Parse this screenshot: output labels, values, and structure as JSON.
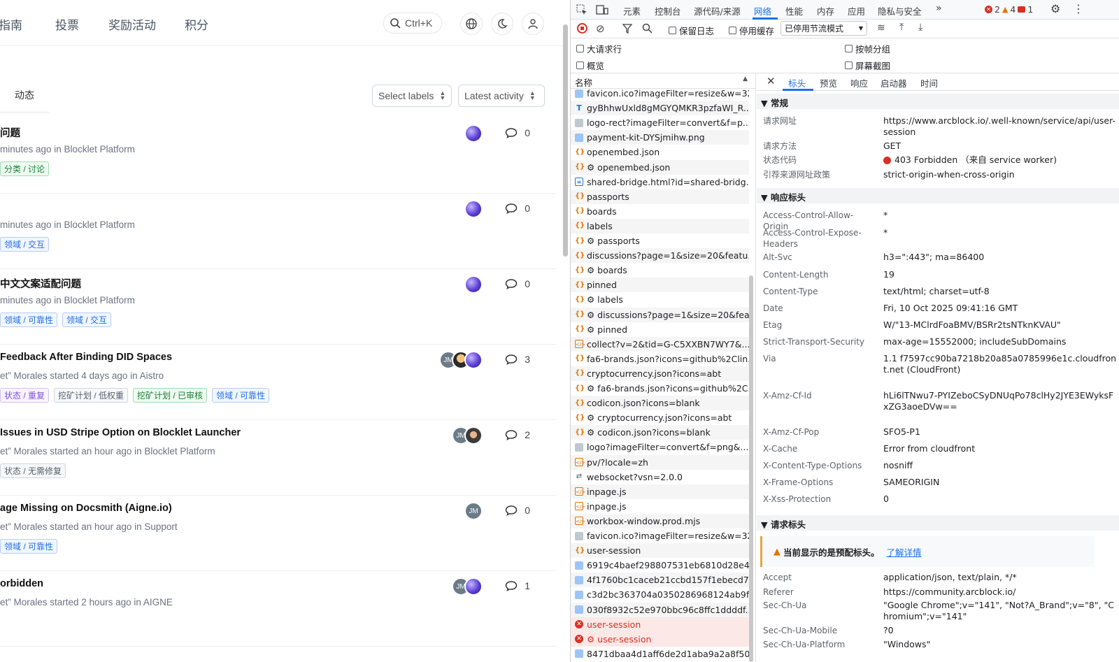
{
  "forum": {
    "nav": [
      "指南",
      "投票",
      "奖励活动",
      "积分"
    ],
    "search_shortcut": "Ctrl+K",
    "tab_label": "动态",
    "select_labels": "Select labels",
    "sort": "Latest activity",
    "topics": [
      {
        "title": "问题",
        "meta": "minutes ago in Blocklet Platform",
        "tags": [
          {
            "text": "分类 / 讨论",
            "color": "green"
          }
        ],
        "avatars": [
          "grad"
        ],
        "comments": "0"
      },
      {
        "title": "",
        "meta": "minutes ago in Blocklet Platform",
        "tags": [
          {
            "text": "领域 / 交互",
            "color": "blue"
          }
        ],
        "avatars": [
          "grad"
        ],
        "comments": "0"
      },
      {
        "title": "中文文案适配问题",
        "meta": "minutes ago in Blocklet Platform",
        "tags": [
          {
            "text": "领域 / 可靠性",
            "color": "blue"
          },
          {
            "text": "领域 / 交互",
            "color": "blue"
          }
        ],
        "avatars": [
          "grad"
        ],
        "comments": "0"
      },
      {
        "title": "Feedback After Binding DID Spaces",
        "meta": "et” Morales started 4 days ago in Aistro",
        "tags": [
          {
            "text": "状态 / 重复",
            "color": "purple"
          },
          {
            "text": "挖矿计划 / 低权重",
            "color": "gray"
          },
          {
            "text": "挖矿计划 / 已审核",
            "color": "green"
          },
          {
            "text": "领域 / 可靠性",
            "color": "blue"
          }
        ],
        "avatars": [
          "grad",
          "photo",
          "jm"
        ],
        "comments": "3"
      },
      {
        "title": "Issues in USD Stripe Option on Blocklet Launcher",
        "meta": "et” Morales started an hour ago in Blocklet Platform",
        "tags": [
          {
            "text": "状态 / 无需修复",
            "color": "gray"
          }
        ],
        "avatars": [
          "photo2",
          "jm"
        ],
        "comments": "2"
      },
      {
        "title": "age Missing on Docsmith (Aigne.io)",
        "meta": "et” Morales started an hour ago in Support",
        "tags": [
          {
            "text": "领域 / 可靠性",
            "color": "blue"
          }
        ],
        "avatars": [
          "jm"
        ],
        "comments": "0"
      },
      {
        "title": "orbidden",
        "meta": "et” Morales started 2 hours ago in AIGNE",
        "tags": [],
        "avatars": [
          "grad",
          "jm"
        ],
        "comments": "1"
      }
    ]
  },
  "devtools": {
    "tabs": [
      "元素",
      "控制台",
      "源代码/来源",
      "网络",
      "性能",
      "内存",
      "应用",
      "隐私与安全"
    ],
    "active_tab": "网络",
    "errors": "2",
    "warnings": "4",
    "issues": "1",
    "preserve_log": "保留日志",
    "disable_cache": "停用缓存",
    "throttle": "已停用节流模式",
    "options": [
      "大请求行",
      "按帧分组",
      "概览",
      "屏幕截图"
    ],
    "name_header": "名称",
    "requests": [
      {
        "name": "favicon.ico?imageFilter=resize&w=32",
        "type": "img"
      },
      {
        "name": "gyBhhwUxld8gMGYQMKR3pzfaWI_R...",
        "type": "font"
      },
      {
        "name": "logo-rect?imageFilter=convert&f=p...",
        "type": "grey"
      },
      {
        "name": "payment-kit-DYSjmihw.png",
        "type": "img"
      },
      {
        "name": "openembed.json",
        "type": "json"
      },
      {
        "name": "⚙ openembed.json",
        "type": "json"
      },
      {
        "name": "shared-bridge.html?id=shared-bridg...",
        "type": "doc"
      },
      {
        "name": "passports",
        "type": "json"
      },
      {
        "name": "boards",
        "type": "json"
      },
      {
        "name": "labels",
        "type": "json"
      },
      {
        "name": "⚙ passports",
        "type": "json"
      },
      {
        "name": "discussions?page=1&size=20&featu...",
        "type": "json"
      },
      {
        "name": "⚙ boards",
        "type": "json"
      },
      {
        "name": "pinned",
        "type": "json"
      },
      {
        "name": "⚙ labels",
        "type": "json"
      },
      {
        "name": "⚙ discussions?page=1&size=20&fea...",
        "type": "json"
      },
      {
        "name": "⚙ pinned",
        "type": "json"
      },
      {
        "name": "collect?v=2&tid=G-C5XXBN7WY7&...",
        "type": "js"
      },
      {
        "name": "fa6-brands.json?icons=github%2Clin...",
        "type": "json"
      },
      {
        "name": "cryptocurrency.json?icons=abt",
        "type": "json"
      },
      {
        "name": "⚙ fa6-brands.json?icons=github%2C...",
        "type": "json"
      },
      {
        "name": "codicon.json?icons=blank",
        "type": "json"
      },
      {
        "name": "⚙ cryptocurrency.json?icons=abt",
        "type": "json"
      },
      {
        "name": "⚙ codicon.json?icons=blank",
        "type": "json"
      },
      {
        "name": "logo?imageFilter=convert&f=png&...",
        "type": "grey"
      },
      {
        "name": "pv/?locale=zh",
        "type": "js"
      },
      {
        "name": "websocket?vsn=2.0.0",
        "type": "ws"
      },
      {
        "name": "inpage.js",
        "type": "js"
      },
      {
        "name": "inpage.js",
        "type": "js"
      },
      {
        "name": "workbox-window.prod.mjs",
        "type": "js"
      },
      {
        "name": "favicon.ico?imageFilter=resize&w=32",
        "type": "grey"
      },
      {
        "name": "user-session",
        "type": "json"
      },
      {
        "name": "6919c4baef298807531eb6810d28e4...",
        "type": "img"
      },
      {
        "name": "4f1760bc1caceb21ccbd157f1ebecd7...",
        "type": "img"
      },
      {
        "name": "c3d2bc363704a0350286968124ab9f...",
        "type": "img"
      },
      {
        "name": "030f8932c52e970bbc96c8ffc1ddddf...",
        "type": "img"
      },
      {
        "name": "user-session",
        "type": "err"
      },
      {
        "name": "⚙ user-session",
        "type": "err"
      },
      {
        "name": "8471dbaa4d1aff6de2d1aba9a2a8f500",
        "type": "img"
      }
    ],
    "detail_tabs": [
      "标头",
      "预览",
      "响应",
      "启动器",
      "时间"
    ],
    "active_detail_tab": "标头",
    "general_title": "▼ 常规",
    "general": [
      {
        "k": "请求网址",
        "v": "https://www.arcblock.io/.well-known/service/api/user-session"
      },
      {
        "k": "请求方法",
        "v": "GET"
      },
      {
        "k": "状态代码",
        "v": "403 Forbidden （来自 service worker)"
      },
      {
        "k": "引荐来源网址政策",
        "v": "strict-origin-when-cross-origin"
      }
    ],
    "response_title": "▼ 响应标头",
    "response": [
      {
        "k": "Access-Control-Allow-Origin",
        "v": "*"
      },
      {
        "k": "Access-Control-Expose-Headers",
        "v": "*"
      },
      {
        "k": "Alt-Svc",
        "v": "h3=\":443\"; ma=86400"
      },
      {
        "k": "Content-Length",
        "v": "19"
      },
      {
        "k": "Content-Type",
        "v": "text/html; charset=utf-8"
      },
      {
        "k": "Date",
        "v": "Fri, 10 Oct 2025 09:41:16 GMT"
      },
      {
        "k": "Etag",
        "v": "W/\"13-MClrdFoaBMV/BSRr2tsNTknKVAU\""
      },
      {
        "k": "Strict-Transport-Security",
        "v": "max-age=15552000; includeSubDomains"
      },
      {
        "k": "Via",
        "v": "1.1 f7597cc90ba7218b20a85a0785996e1c.cloudfront.net (CloudFront)"
      },
      {
        "k": "X-Amz-Cf-Id",
        "v": "hLi6lTNwu7-PYIZeboCSyDNUqPo78clHy2JYE3EWyksFxZG3aoeDVw=="
      },
      {
        "k": "X-Amz-Cf-Pop",
        "v": "SFO5-P1"
      },
      {
        "k": "X-Cache",
        "v": "Error from cloudfront"
      },
      {
        "k": "X-Content-Type-Options",
        "v": "nosniff"
      },
      {
        "k": "X-Frame-Options",
        "v": "SAMEORIGIN"
      },
      {
        "k": "X-Xss-Protection",
        "v": "0"
      }
    ],
    "request_title": "▼ 请求标头",
    "warning": "当前显示的是预配标头。",
    "learn_more": "了解详情",
    "request": [
      {
        "k": "Accept",
        "v": "application/json, text/plain, */*"
      },
      {
        "k": "Referer",
        "v": "https://community.arcblock.io/"
      },
      {
        "k": "Sec-Ch-Ua",
        "v": "\"Google Chrome\";v=\"141\", \"Not?A_Brand\";v=\"8\", \"Chromium\";v=\"141\""
      },
      {
        "k": "Sec-Ch-Ua-Mobile",
        "v": "?0"
      },
      {
        "k": "Sec-Ch-Ua-Platform",
        "v": "\"Windows\""
      }
    ],
    "colors": {
      "accent": "#1a73e8",
      "error": "#d93025",
      "warning": "#e37400"
    }
  }
}
